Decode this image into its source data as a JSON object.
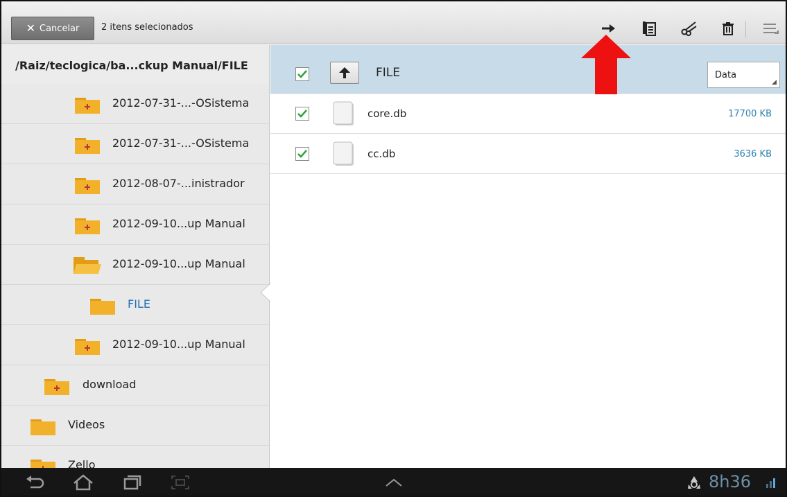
{
  "actionbar": {
    "cancel_label": "Cancelar",
    "selection_text": "2 itens selecionados",
    "icons": [
      "move-arrow-icon",
      "copy-icon",
      "cut-scissors-icon",
      "delete-trash-icon",
      "menu-icon"
    ]
  },
  "left_panel": {
    "path": "/Raiz/teclogica/ba...ckup Manual/FILE",
    "items": [
      {
        "label": "2012-07-31-...-OSistema",
        "icon": "folder-plus-icon"
      },
      {
        "label": "2012-07-31-...-OSistema",
        "icon": "folder-plus-icon"
      },
      {
        "label": "2012-08-07-...inistrador",
        "icon": "folder-plus-icon"
      },
      {
        "label": "2012-09-10...up Manual",
        "icon": "folder-plus-icon"
      },
      {
        "label": "2012-09-10...up Manual",
        "icon": "folder-open-icon"
      },
      {
        "label": "FILE",
        "icon": "folder-icon",
        "active": true
      },
      {
        "label": "2012-09-10...up Manual",
        "icon": "folder-plus-icon"
      },
      {
        "label": "download",
        "icon": "folder-plus-icon"
      },
      {
        "label": "Videos",
        "icon": "folder-icon"
      },
      {
        "label": "Zello",
        "icon": "folder-plus-icon"
      }
    ]
  },
  "file_list": {
    "current_folder": "FILE",
    "sort_value": "Data",
    "files": [
      {
        "name": "core.db",
        "size": "17700 KB",
        "checked": true
      },
      {
        "name": "cc.db",
        "size": "3636 KB",
        "checked": true
      }
    ]
  },
  "sysbar": {
    "clock": "8h36",
    "icons": [
      "back-icon",
      "home-icon",
      "recent-apps-icon",
      "screenshot-icon",
      "up-chevron-icon",
      "recycle-icon",
      "signal-icon"
    ]
  },
  "colors": {
    "accent_blue": "#1f6fb3",
    "size_text": "#2a7fae",
    "header_row": "#c8dbe8",
    "folder": "#f2b12a",
    "check_green": "#2fa33b",
    "annotation_red": "#ee1111"
  }
}
